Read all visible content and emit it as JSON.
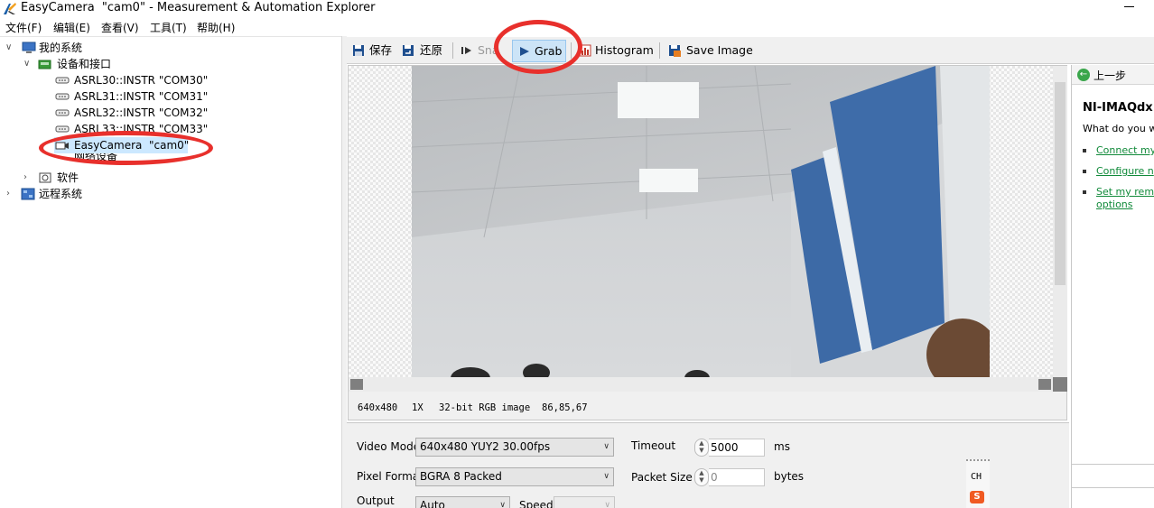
{
  "window": {
    "title": "EasyCamera  \"cam0\" - Measurement & Automation Explorer"
  },
  "menu": {
    "items": [
      "文件(F)",
      "编辑(E)",
      "查看(V)",
      "工具(T)",
      "帮助(H)"
    ]
  },
  "tree": {
    "my_system": "我的系统",
    "devices": "设备和接口",
    "ports": [
      "ASRL30::INSTR \"COM30\"",
      "ASRL31::INSTR \"COM31\"",
      "ASRL32::INSTR \"COM32\"",
      "ASRL33::INSTR \"COM33\""
    ],
    "camera": "EasyCamera  \"cam0\"",
    "network_devices": "网络设备",
    "software": "软件",
    "remote_systems": "远程系统"
  },
  "toolbar": {
    "save": "保存",
    "revert": "还原",
    "snap": "Snap",
    "grab": "Grab",
    "histogram": "Histogram",
    "save_image": "Save Image"
  },
  "image_status": {
    "resolution": "640x480",
    "zoom": "1X",
    "image_type": "32-bit RGB image",
    "pixel_value": "86,85,67"
  },
  "settings": {
    "video_mode_label": "Video Mode",
    "video_mode_value": "640x480 YUY2 30.00fps",
    "pixel_format_label": "Pixel Format",
    "pixel_format_value": "BGRA 8 Packed",
    "output_label": "Output",
    "output_value": "Auto",
    "speed_label": "Speed",
    "speed_value": "",
    "timeout_label": "Timeout",
    "timeout_value": "5000",
    "timeout_unit": "ms",
    "packet_size_label": "Packet Size",
    "packet_size_value": "0",
    "packet_size_unit": "bytes",
    "ime_label": "CH"
  },
  "help": {
    "back": "上一步",
    "title": "NI-IMAQdx",
    "question": "What do you w",
    "links": [
      "Connect my",
      "Configure n",
      "Set my rem",
      "options"
    ]
  },
  "colors": {
    "accent": "#cce4f7",
    "selection": "#cce8ff",
    "annotation": "#e8302c",
    "link": "#118a3a"
  }
}
